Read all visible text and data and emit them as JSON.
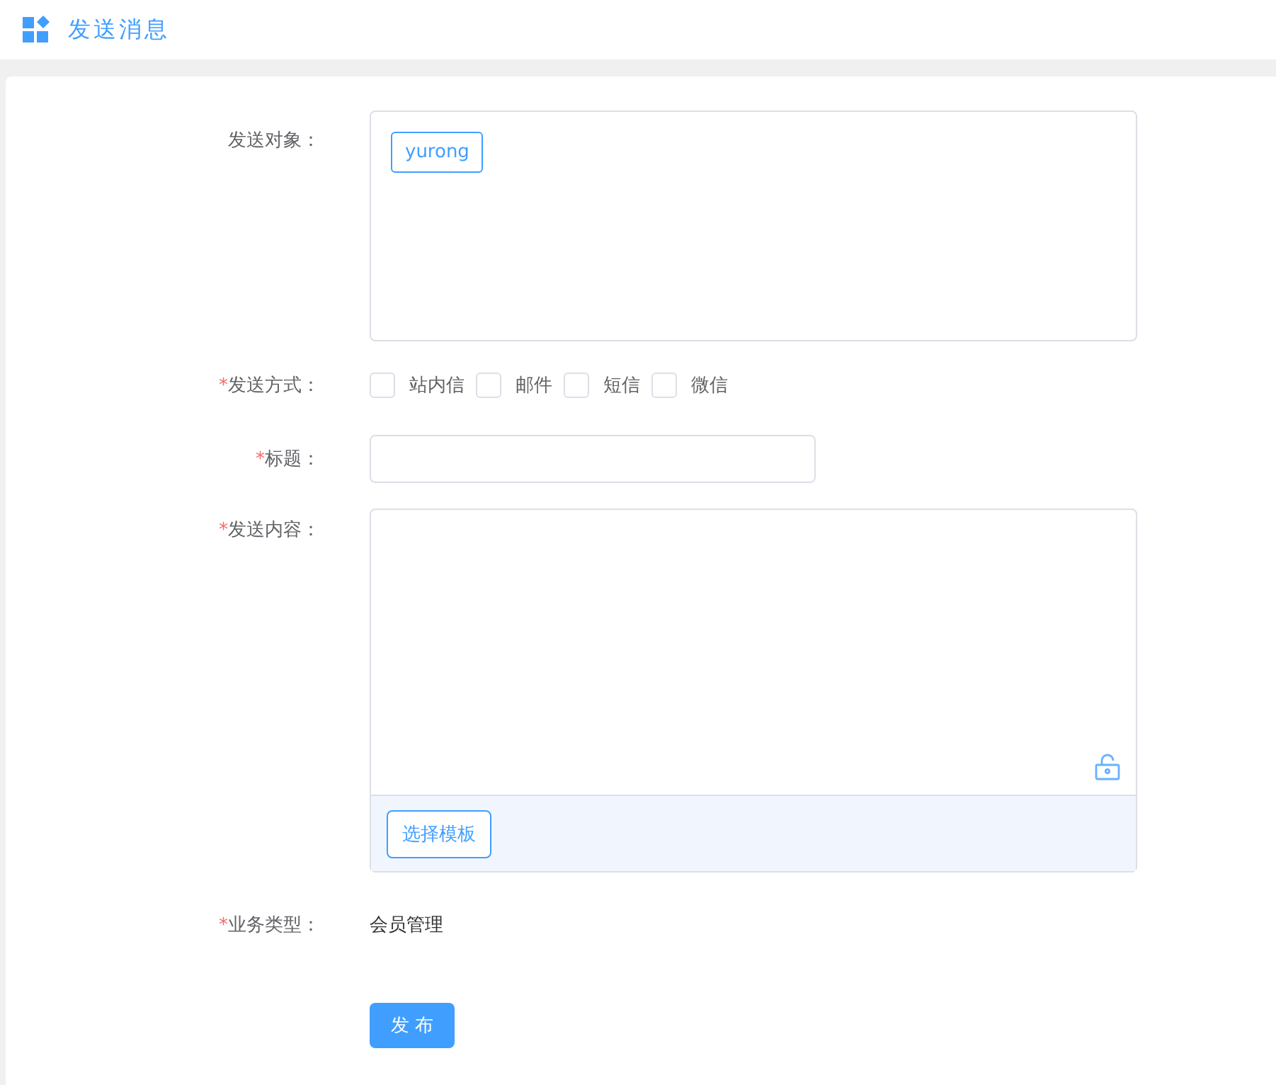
{
  "header": {
    "title": "发送消息"
  },
  "form": {
    "recipients": {
      "label": "发送对象：",
      "tags": [
        "yurong"
      ]
    },
    "methods": {
      "label": "发送方式：",
      "required_mark": "*",
      "options": [
        {
          "label": "站内信",
          "checked": false
        },
        {
          "label": "邮件",
          "checked": false
        },
        {
          "label": "短信",
          "checked": false
        },
        {
          "label": "微信",
          "checked": false
        }
      ]
    },
    "title": {
      "label": "标题：",
      "required_mark": "*"
    },
    "content": {
      "label": "发送内容：",
      "required_mark": "*",
      "template_button": "选择模板"
    },
    "business_type": {
      "label": "业务类型：",
      "required_mark": "*",
      "value": "会员管理"
    },
    "submit": "发 布"
  }
}
